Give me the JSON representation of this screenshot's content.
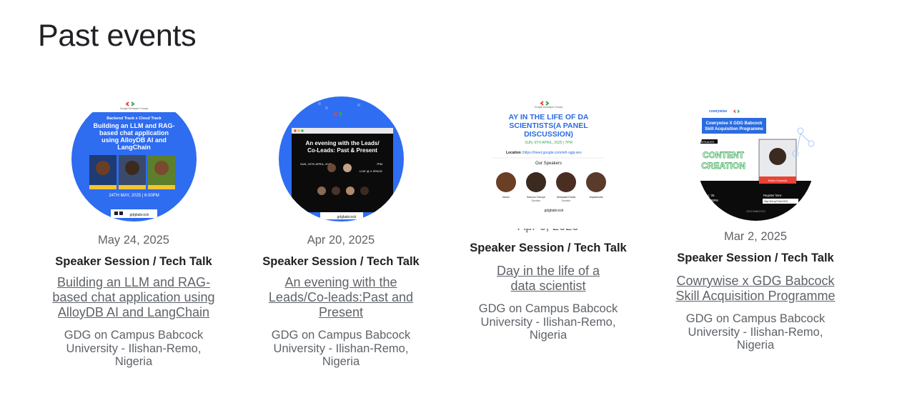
{
  "section": {
    "title": "Past events"
  },
  "events": [
    {
      "date": "May 24, 2025",
      "type": "Speaker Session / Tech Talk",
      "title": "Building an LLM and RAG-based chat application using AlloyDB AI and LangChain",
      "chapter": "GDG on Campus Babcock University - Ilishan-Remo, Nigeria",
      "thumb": {
        "org": "Google Developer Groups",
        "track": "Backend Track x Cloud Track",
        "headline": [
          "Building an LLM and RAG-",
          "based chat application",
          "using AlloyDB AI and",
          "LangChain"
        ],
        "date_line": "24TH MAY, 2025 | 6:00PM",
        "handle": "gdgbabcock"
      }
    },
    {
      "date": "Apr 20, 2025",
      "type": "Speaker Session / Tech Talk",
      "title": "An evening with the Leads/Co-leads:Past and Present",
      "chapter": "GDG on Campus Babcock University - Ilishan-Remo, Nigeria",
      "thumb": {
        "headline": [
          "An evening with the Leads/",
          "Co-Leads: Past & Present"
        ],
        "date_line": "SUN, 20TH APRIL, 2025",
        "time": "7PM",
        "venue": "LIVE @ X SPACE",
        "handle": "gdgbabcock"
      }
    },
    {
      "date": "Apr 6, 2025",
      "type": "Speaker Session / Tech Talk",
      "title": "Day in the life of a data scientist",
      "chapter": "GDG on Campus Babcock University - Ilishan-Remo, Nigeria",
      "thumb": {
        "org": "Google Developer Groups",
        "headline": [
          "AY IN THE LIFE OF DA",
          "SCIENTISTS(A PANEL",
          "DISCUSSION)"
        ],
        "date_line": "SUN, 6TH APRIL, 2025 | 7PM",
        "location_label": "Location :",
        "location_url": "https://meet.google.com/wfr-xgpj-sev",
        "speakers_label": "Our Speakers",
        "speakers": [
          "Nonso",
          "Samson Tomoye",
          "Afolasade Eniola",
          "Anjolaoluwa"
        ],
        "speaker_role": "Speaker",
        "handle": "gdgbabcock"
      }
    },
    {
      "date": "Mar 2, 2025",
      "type": "Speaker Session / Tech Talk",
      "title": "Cowrywise x GDG Babcock Skill Acquisition Programme",
      "chapter": "GDG on Campus Babcock University - Ilishan-Remo, Nigeria",
      "thumb": {
        "brand": "cowrywise",
        "headline": [
          "Cowrywise X GDG Babcock",
          "Skill Acquisition Programme"
        ],
        "speaker_tag": "SPEAKER",
        "topic": [
          "CONTENT",
          "CREATION"
        ],
        "speaker_name": "Esther Omowolo",
        "date_line": "1st Mar, '25",
        "time": "7PM - 9:30PM",
        "register_label": "Register here:",
        "register_url": "http://bit.ly/CWxGDG",
        "footer": "GDG BABCOCK"
      }
    }
  ],
  "colors": {
    "text_primary": "#202124",
    "text_secondary": "#5f6368",
    "google_blue": "#4285f4",
    "google_red": "#ea4335",
    "google_yellow": "#fbbc04",
    "google_green": "#34a853"
  }
}
